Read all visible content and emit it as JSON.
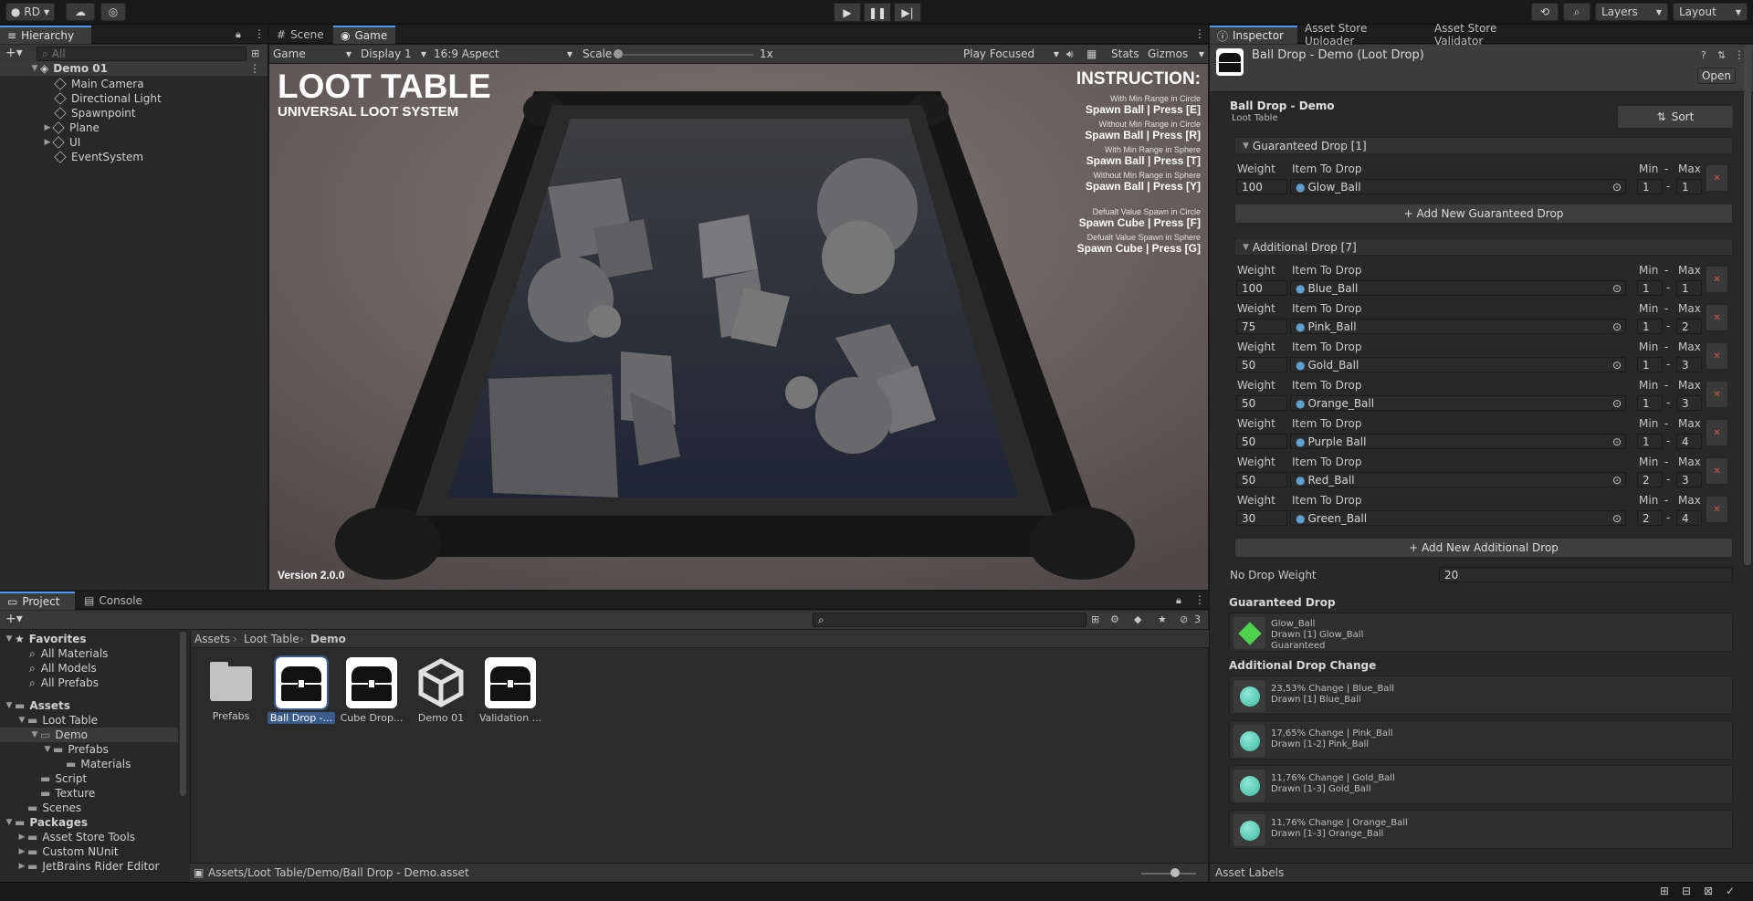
{
  "topbar": {
    "account": "RD",
    "layers": "Layers",
    "layout": "Layout"
  },
  "hierarchy": {
    "tab": "Hierarchy",
    "search_placeholder": "All",
    "scene": "Demo 01",
    "items": [
      "Main Camera",
      "Directional Light",
      "Spawnpoint",
      "Plane",
      "UI",
      "EventSystem"
    ]
  },
  "game": {
    "tabs": [
      "Scene",
      "Game"
    ],
    "toolbar": {
      "mode": "Game",
      "display": "Display 1",
      "aspect": "16:9 Aspect",
      "scale_label": "Scale",
      "scale_value": "1x",
      "play_mode": "Play Focused",
      "stats": "Stats",
      "gizmos": "Gizmos"
    },
    "title": "LOOT TABLE",
    "subtitle": "UNIVERSAL LOOT SYSTEM",
    "version": "Version 2.0.0",
    "instruction_title": "INSTRUCTION:",
    "instructions": [
      {
        "small": "With Min Range in Circle",
        "big": "Spawn Ball | Press [E]"
      },
      {
        "small": "Without Min Range in Circle",
        "big": "Spawn Ball | Press [R]"
      },
      {
        "small": "With Min Range in Sphere",
        "big": "Spawn Ball | Press [T]"
      },
      {
        "small": "Without Min Range in Sphere",
        "big": "Spawn Ball | Press [Y]"
      },
      {
        "small": "Defualt Value Spawn in Circle",
        "big": "Spawn Cube | Press [F]"
      },
      {
        "small": "Defualt Value Spawn in Sphere",
        "big": "Spawn Cube | Press [G]"
      }
    ]
  },
  "inspector": {
    "tabs": [
      "Inspector",
      "Asset Store Uploader",
      "Asset Store Validator"
    ],
    "header_title": "Ball Drop - Demo (Loot Drop)",
    "open_label": "Open",
    "object_name": "Ball Drop - Demo",
    "object_type": "Loot Table",
    "sort_label": "Sort",
    "col_weight": "Weight",
    "col_item": "Item To Drop",
    "col_min": "Min",
    "col_dash": "-",
    "col_max": "Max",
    "guaranteed_header": "Guaranteed Drop [1]",
    "guaranteed": [
      {
        "weight": "100",
        "item": "Glow_Ball",
        "min": "1",
        "max": "1"
      }
    ],
    "add_guaranteed": "+ Add New Guaranteed Drop",
    "additional_header": "Additional Drop [7]",
    "additional": [
      {
        "weight": "100",
        "item": "Blue_Ball",
        "min": "1",
        "max": "1"
      },
      {
        "weight": "75",
        "item": "Pink_Ball",
        "min": "1",
        "max": "2"
      },
      {
        "weight": "50",
        "item": "Gold_Ball",
        "min": "1",
        "max": "3"
      },
      {
        "weight": "50",
        "item": "Orange_Ball",
        "min": "1",
        "max": "3"
      },
      {
        "weight": "50",
        "item": "Purple Ball",
        "min": "1",
        "max": "4"
      },
      {
        "weight": "50",
        "item": "Red_Ball",
        "min": "2",
        "max": "3"
      },
      {
        "weight": "30",
        "item": "Green_Ball",
        "min": "2",
        "max": "4"
      }
    ],
    "add_additional": "+ Add New Additional Drop",
    "no_drop_label": "No Drop Weight",
    "no_drop_value": "20",
    "preview_guaranteed_title": "Guaranteed Drop",
    "preview_guaranteed": {
      "l1": "Glow_Ball",
      "l2": "Drawn [1] Glow_Ball",
      "l3": "Guaranteed",
      "color": "#4fd04f"
    },
    "preview_additional_title": "Additional Drop Change",
    "preview_additional": [
      {
        "l1": "23,53% Change | Blue_Ball",
        "l2": "Drawn [1] Blue_Ball"
      },
      {
        "l1": "17,65% Change | Pink_Ball",
        "l2": "Drawn [1-2] Pink_Ball"
      },
      {
        "l1": "11,76% Change | Gold_Ball",
        "l2": "Drawn [1-3] Gold_Ball"
      },
      {
        "l1": "11,76% Change | Orange_Ball",
        "l2": "Drawn [1-3] Orange_Ball"
      }
    ],
    "asset_labels": "Asset Labels"
  },
  "project": {
    "tabs": [
      "Project",
      "Console"
    ],
    "hidden_count": "3",
    "favorites": "Favorites",
    "fav_items": [
      "All Materials",
      "All Models",
      "All Prefabs"
    ],
    "assets": "Assets",
    "loot_table": "Loot Table",
    "demo": "Demo",
    "prefabs": "Prefabs",
    "materials": "Materials",
    "script": "Script",
    "texture": "Texture",
    "scenes": "Scenes",
    "packages": "Packages",
    "packages_items": [
      "Asset Store Tools",
      "Custom NUnit",
      "JetBrains Rider Editor"
    ],
    "breadcrumb": [
      "Assets",
      "Loot Table",
      "Demo"
    ],
    "tiles": [
      "Prefabs",
      "Ball Drop -...",
      "Cube Drop...",
      "Demo 01",
      "Validation ..."
    ],
    "path": "Assets/Loot Table/Demo/Ball Drop - Demo.asset"
  }
}
